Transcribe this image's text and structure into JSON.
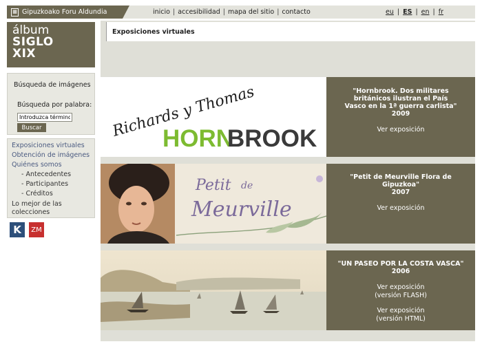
{
  "top": {
    "brand": "Gipuzkoako Foru Aldundia",
    "nav": [
      "inicio",
      "accesibilidad",
      "mapa del sitio",
      "contacto"
    ],
    "languages": [
      "eu",
      "ES",
      "en",
      "fr"
    ],
    "active_language": "ES"
  },
  "logo": {
    "line1": "álbum",
    "line2": "SIGLO",
    "line3": "XIX"
  },
  "search": {
    "heading": "Búsqueda de imágenes",
    "label": "Búsqueda por palabra:",
    "input_value": "Introduzca término",
    "button": "Buscar"
  },
  "sidebar": {
    "items": [
      {
        "label": "Exposiciones virtuales",
        "level": 0
      },
      {
        "label": "Obtención de imágenes",
        "level": 0
      },
      {
        "label": "Quiénes somos",
        "level": 0
      },
      {
        "label": "- Antecedentes",
        "level": 1
      },
      {
        "label": "- Participantes",
        "level": 1
      },
      {
        "label": "- Créditos",
        "level": 1
      },
      {
        "label": "Lo mejor de las colecciones",
        "level": 0
      }
    ]
  },
  "partner_logos": {
    "k": "K",
    "zm": "ZM"
  },
  "main": {
    "title": "Exposiciones virtuales",
    "exhibitions": [
      {
        "art_line1": "Richards y Thomas",
        "art_line2a": "HORN",
        "art_line2b": "BROOK",
        "title": "\"Hornbrook. Dos militares británicos ilustran el País Vasco en la 1ª guerra carlista\"",
        "year": "2009",
        "links": [
          "Ver exposición"
        ]
      },
      {
        "art_line1": "Petit",
        "art_line2": "de",
        "art_line3": "Meurville",
        "title": "\"Petit de Meurville Flora de Gipuzkoa\"",
        "year": "2007",
        "links": [
          "Ver exposición"
        ]
      },
      {
        "title": "\"UN PASEO POR LA COSTA VASCA\"",
        "year": "2006",
        "links": [
          "Ver exposición (versión FLASH)",
          "Ver exposición (versión HTML)"
        ]
      }
    ]
  },
  "colors": {
    "accent": "#6b6650",
    "topbar_bg": "#e3e3dc",
    "hornbrook_green": "#7dbb31",
    "hornbrook_dark": "#3a3a3a",
    "meurville_purple": "#7b6a9a"
  }
}
